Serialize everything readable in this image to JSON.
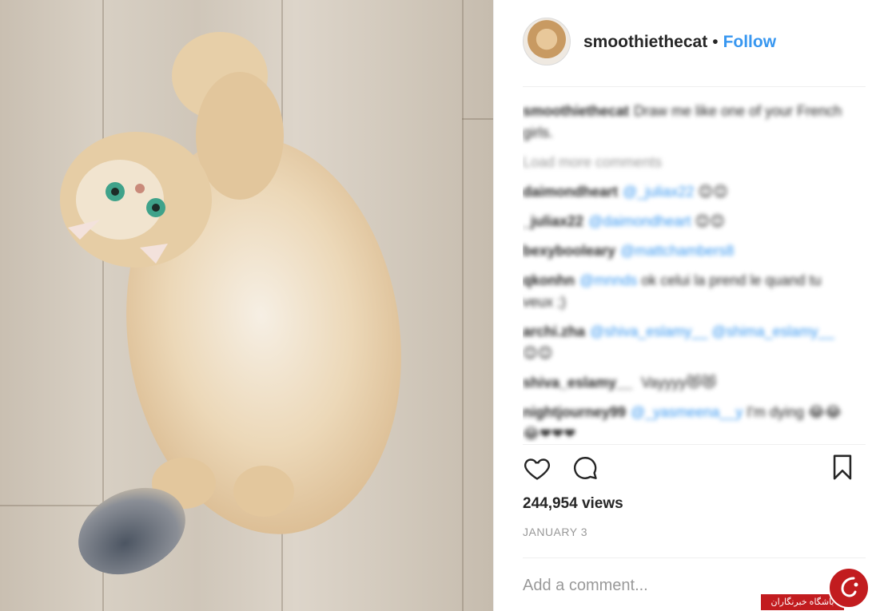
{
  "post": {
    "username": "smoothiethecat",
    "separator": "•",
    "follow_label": "Follow",
    "views": "244,954 views",
    "date": "JANUARY 3",
    "comment_placeholder": "Add a comment..."
  },
  "caption": {
    "user": "smoothiethecat",
    "text": "Draw me like one of your French girls."
  },
  "load_more": "Load more comments",
  "comments": [
    {
      "user": "daimondheart",
      "mention": "@_juliax22",
      "text": "😊😊"
    },
    {
      "user": "_juliax22",
      "mention": "@daimondheart",
      "text": "😊😊"
    },
    {
      "user": "bexybooleary",
      "mention": "@mattchambers8",
      "text": ""
    },
    {
      "user": "qkonhn",
      "mention": "@mnnds",
      "text": "ok celui la prend le quand tu veux ;)"
    },
    {
      "user": "archi.zha",
      "mention": "@shiva_eslamy__ @shima_eslamy__",
      "text": "😊😊"
    },
    {
      "user": "shiva_eslamy__",
      "mention": "",
      "text": "Vayyyy😻😻"
    },
    {
      "user": "nightjourney99",
      "mention": "@_yasmeena__y",
      "text": "I'm dying 😂😂😂❤❤❤"
    }
  ],
  "icons": {
    "like": "heart-icon",
    "comment": "comment-bubble-icon",
    "save": "bookmark-icon"
  },
  "watermark": {
    "text": "باشگاه خبرنگاران"
  },
  "colors": {
    "link": "#3897f0",
    "muted": "#999999",
    "text": "#262626",
    "watermark": "#c21c1f"
  }
}
